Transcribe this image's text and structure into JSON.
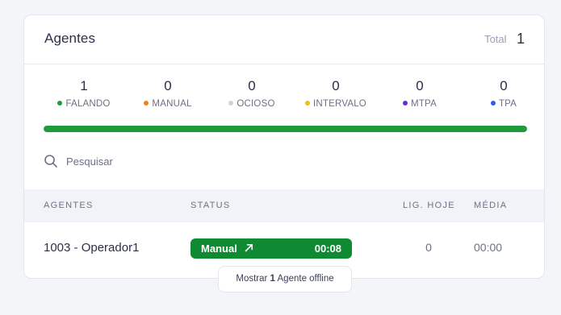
{
  "card": {
    "title": "Agentes",
    "total_label": "Total",
    "total_value": "1"
  },
  "stats": [
    {
      "value": "1",
      "label": "FALANDO",
      "color": "#1e9b3b"
    },
    {
      "value": "0",
      "label": "MANUAL",
      "color": "#f0801e"
    },
    {
      "value": "0",
      "label": "OCIOSO",
      "color": "#cfd3de"
    },
    {
      "value": "0",
      "label": "INTERVALO",
      "color": "#f2be12"
    },
    {
      "value": "0",
      "label": "MTPA",
      "color": "#6a2bd9"
    },
    {
      "value": "0",
      "label": "TPA",
      "color": "#2f5bf0"
    }
  ],
  "progress": {
    "fraction": 1.0,
    "color": "#1e9b3b"
  },
  "search": {
    "placeholder": "Pesquisar",
    "icon": "search-icon"
  },
  "table": {
    "headers": {
      "agent": "AGENTES",
      "status": "STATUS",
      "calls_today": "LIG. HOJE",
      "average": "MÉDIA"
    },
    "rows": [
      {
        "agent": "1003 - Operador1",
        "status": "Manual",
        "status_icon": "arrow-up-right-icon",
        "status_time": "00:08",
        "status_color": "#0f8a32",
        "calls_today": "0",
        "average": "00:00"
      }
    ]
  },
  "offline_button": {
    "prefix": "Mostrar",
    "count": "1",
    "suffix": "Agente offline"
  }
}
